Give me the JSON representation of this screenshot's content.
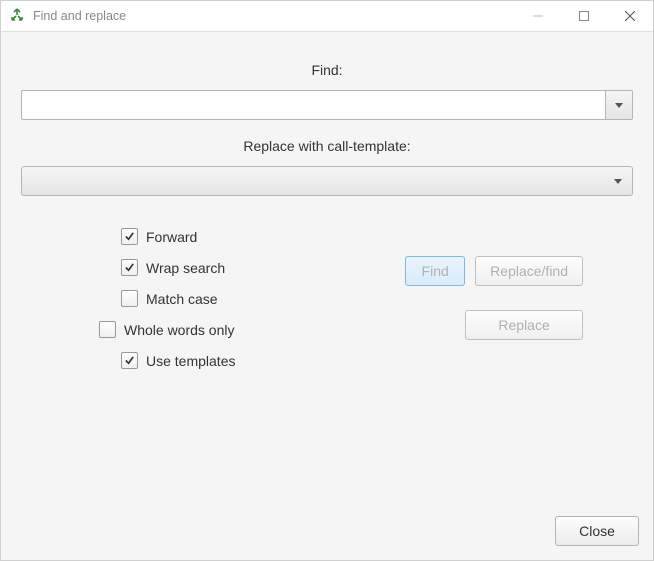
{
  "window": {
    "title": "Find and replace"
  },
  "labels": {
    "find": "Find:",
    "replace_with": "Replace with call-template:"
  },
  "inputs": {
    "find_value": "",
    "find_placeholder": "",
    "replace_selected": ""
  },
  "options": {
    "forward": {
      "label": "Forward",
      "checked": true
    },
    "wrap": {
      "label": "Wrap search",
      "checked": true
    },
    "match_case": {
      "label": "Match case",
      "checked": false
    },
    "whole_words": {
      "label": "Whole words only",
      "checked": false
    },
    "use_templates": {
      "label": "Use templates",
      "checked": true
    }
  },
  "buttons": {
    "find": "Find",
    "replace_find": "Replace/find",
    "replace": "Replace",
    "close": "Close"
  }
}
